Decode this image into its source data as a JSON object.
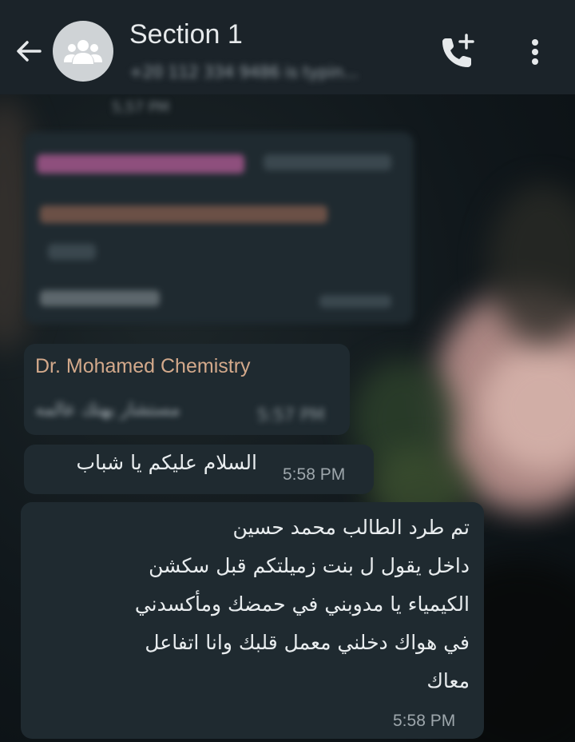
{
  "header": {
    "title": "Section 1",
    "subtitle": "+20 112 334 9486 is typin..."
  },
  "messages": [
    {
      "sender": "Dr. Mohamed Chemistry",
      "text": "مستشار يهتك عالمه",
      "time": "5:57 PM"
    },
    {
      "text": "السلام عليكم يا شباب",
      "time": "5:58 PM"
    },
    {
      "lines": [
        "تم طرد الطالب محمد حسين",
        "داخل يقول ل بنت زميلتكم قبل سكشن",
        "الكيمياء يا مدوبني في حمضك ومأكسدني",
        "في هواك دخلني معمل قلبك وانا اتفاعل",
        "معاك"
      ],
      "time": "5:58 PM"
    }
  ],
  "colors": {
    "header_bg": "#1b2329",
    "bubble_bg": "#1f2a30",
    "sender_name": "#d3a98b"
  },
  "icons": [
    "back-arrow-icon",
    "group-avatar-icon",
    "add-call-icon",
    "more-options-icon"
  ]
}
